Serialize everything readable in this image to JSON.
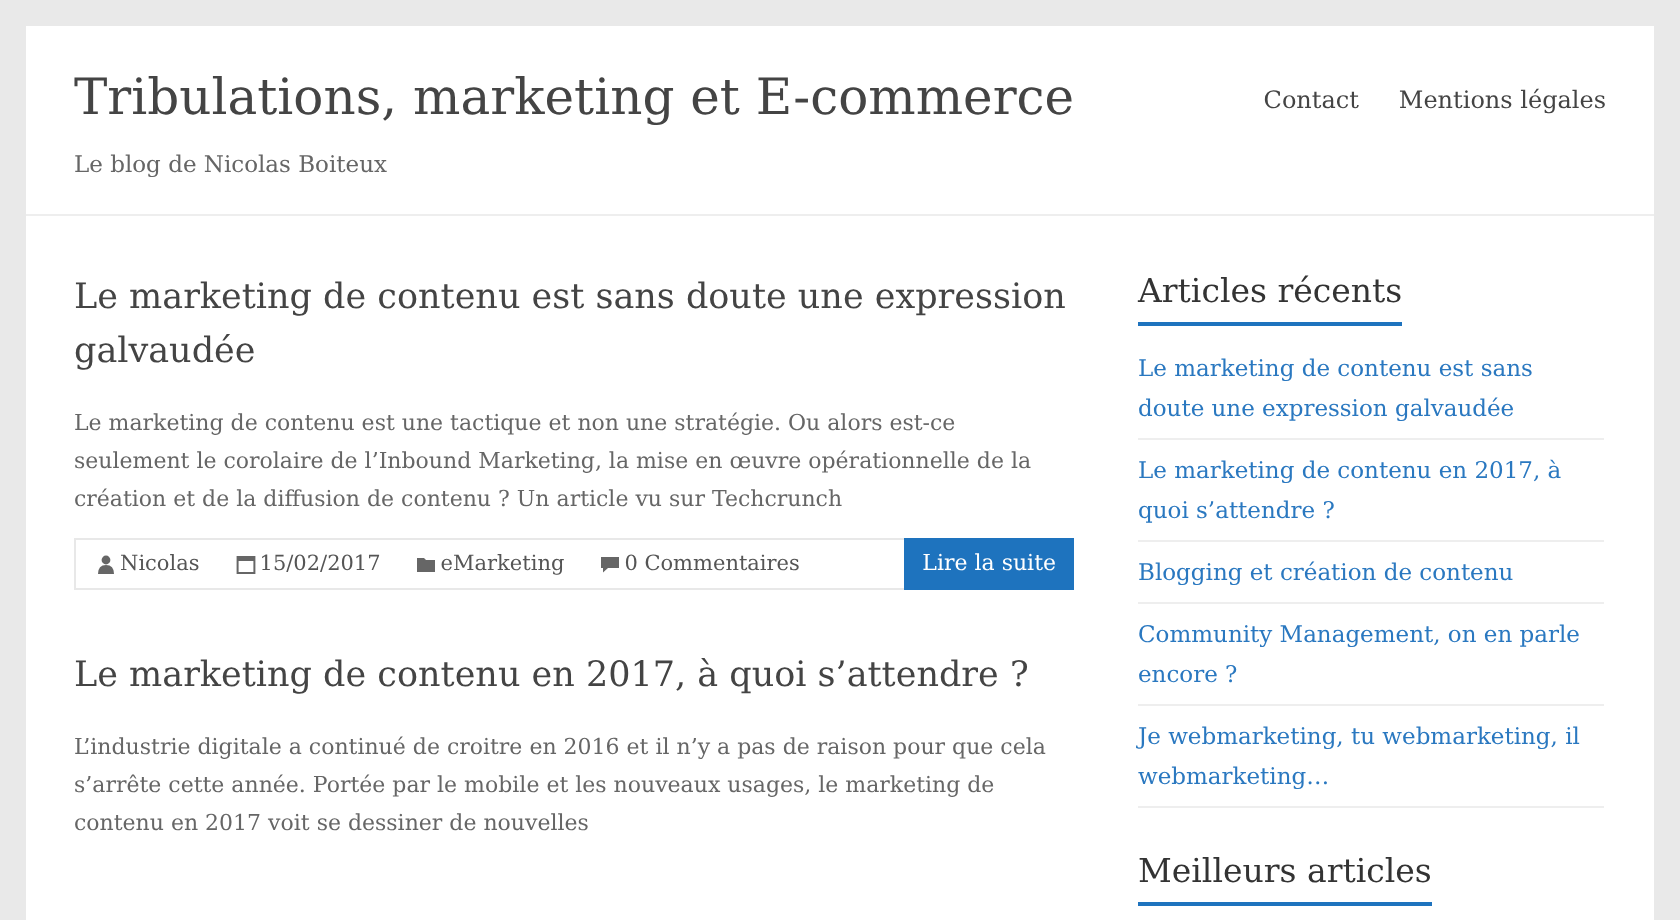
{
  "site": {
    "title": "Tribulations, marketing et E-commerce",
    "tagline": "Le blog de Nicolas Boiteux"
  },
  "nav": [
    "Contact",
    "Mentions légales"
  ],
  "posts": [
    {
      "title": "Le marketing de contenu est sans doute une expression galvaudée",
      "excerpt": "Le marketing de contenu est une tactique et non une stratégie. Ou alors est-ce seulement le corolaire de l’Inbound Marketing, la mise en œuvre opérationnelle de la création et de la diffusion de contenu ? Un article vu sur Techcrunch",
      "meta": [
        {
          "kind": "author",
          "text": "Nicolas"
        },
        {
          "kind": "date",
          "text": "15/02/2017"
        },
        {
          "kind": "category",
          "text": "eMarketing"
        },
        {
          "kind": "comments",
          "text": "0 Commentaires"
        }
      ],
      "button": "Lire la suite"
    },
    {
      "title": "Le marketing de contenu en 2017, à quoi s’attendre ?",
      "excerpt": "L’industrie digitale a continué de croitre en 2016 et il n’y a pas de raison pour que cela s’arrête cette année. Portée par le mobile et les nouveaux usages, le marketing de contenu en 2017 voit se dessiner de nouvelles"
    }
  ],
  "sidebar": [
    {
      "heading": "Articles récents",
      "items": [
        "Le marketing de contenu est sans doute une expression galvaudée",
        "Le marketing de contenu en 2017, à quoi s’attendre ?",
        "Blogging et création de contenu",
        "Community Management, on en parle encore ?",
        "Je webmarketing, tu webmarketing, il webmarketing…"
      ]
    },
    {
      "heading": "Meilleurs articles"
    }
  ]
}
